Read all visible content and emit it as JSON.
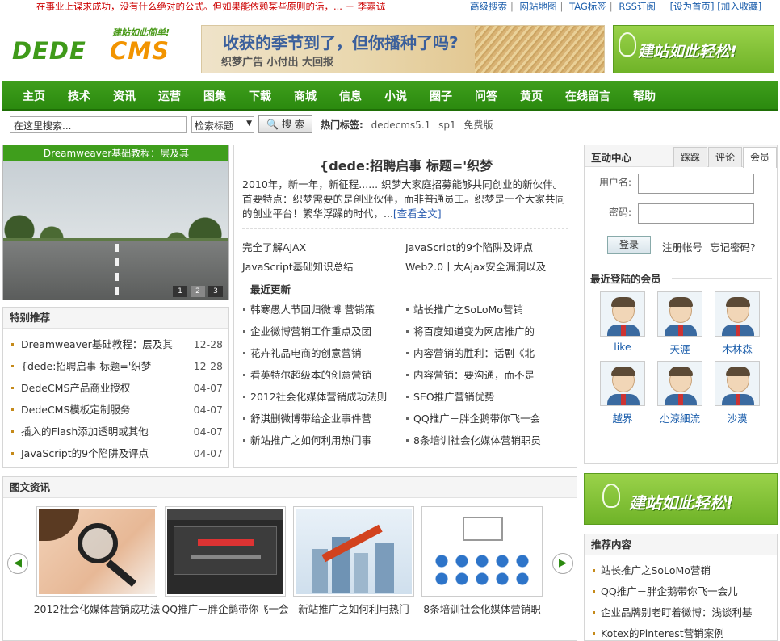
{
  "topbar": {
    "motto": "在事业上谋求成功，没有什么绝对的公式。但如果能依赖某些原则的话，... － 李嘉诚",
    "links": [
      "高级搜索",
      "网站地图",
      "TAG标签",
      "RSS订阅"
    ],
    "right_links": [
      "[设为首页]",
      "[加入收藏]"
    ]
  },
  "logo": {
    "slogan": "建站如此简单!",
    "part1": "DEDE",
    "part2": "CMS"
  },
  "banner1": {
    "title": "收获的季节到了，但你播种了吗?",
    "sub": "织梦广告 小付出 大回报"
  },
  "banner2": {
    "text": "建站如此轻松!"
  },
  "nav": [
    "主页",
    "技术",
    "资讯",
    "运营",
    "图集",
    "下载",
    "商城",
    "信息",
    "小说",
    "圈子",
    "问答",
    "黄页",
    "在线留言",
    "帮助"
  ],
  "search": {
    "value": "在这里搜索...",
    "select": "检索标题",
    "button": "搜 索",
    "hot_label": "热门标签:",
    "tags": [
      "dedecms5.1",
      "sp1",
      "免费版"
    ]
  },
  "slideshow": {
    "caption": "Dreamweaver基础教程：层及其",
    "pages": [
      "1",
      "2",
      "3"
    ]
  },
  "special": {
    "title": "特别推荐",
    "items": [
      {
        "t": "Dreamweaver基础教程：层及其",
        "d": "12-28"
      },
      {
        "t": "{dede:招聘启事 标题='织梦",
        "d": "12-28"
      },
      {
        "t": "DedeCMS产品商业授权",
        "d": "04-07"
      },
      {
        "t": "DedeCMS模板定制服务",
        "d": "04-07"
      },
      {
        "t": "插入的Flash添加透明或其他",
        "d": "04-07"
      },
      {
        "t": "JavaScript的9个陷阱及评点",
        "d": "04-07"
      }
    ]
  },
  "center": {
    "headline": "{dede:招聘启事 标题='织梦",
    "desc": "2010年，新一年，新征程...... 织梦大家庭招募能够共同创业的新伙伴。 首要特点：织梦需要的是创业伙伴，而非普通员工。织梦是一个大家共同的创业平台！繁华浮躁的时代，...",
    "more": "[查看全文]",
    "quick": [
      "完全了解AJAX",
      "JavaScript的9个陷阱及评点",
      "JavaScript基础知识总结",
      "Web2.0十大Ajax安全漏洞以及"
    ],
    "latest_title": "最近更新",
    "latest": [
      "韩寒愚人节回归微博 营销策",
      "站长推广之SoLoMo营销",
      "企业微博营销工作重点及团",
      "将百度知道变为网店推广的",
      "花卉礼品电商的创意营销",
      "内容营销的胜利：话剧《北",
      "看英特尔超级本的创意营销",
      "内容营销：要沟通，而不是",
      "2012社会化媒体营销成功法则",
      "SEO推广营销优势",
      "舒淇删微博带给企业事件营",
      "QQ推广－胖企鹅带你飞一会",
      "新站推广之如何利用热门事",
      "8条培训社会化媒体营销职员"
    ]
  },
  "member": {
    "title": "互动中心",
    "tabs": [
      "踩踩",
      "评论",
      "会员"
    ],
    "username_label": "用户名:",
    "password_label": "密码:",
    "login": "登录",
    "register": "注册帐号",
    "forgot": "忘记密码?",
    "recent_title": "最近登陆的会员",
    "users": [
      "like",
      "天涯",
      "木林森",
      "越界",
      "尐涼細流",
      "沙漠"
    ]
  },
  "banner3": {
    "text": "建站如此轻松!"
  },
  "recommend": {
    "title": "推荐内容",
    "items": [
      "站长推广之SoLoMo营销",
      "QQ推广－胖企鹅带你飞一会儿",
      "企业品牌别老盯着微博：浅谈利基",
      "Kotex的Pinterest营销案例"
    ]
  },
  "picnews": {
    "title": "图文资讯",
    "items": [
      "2012社会化媒体营销成功法",
      "QQ推广－胖企鹅带你飞一会",
      "新站推广之如何利用热门",
      "8条培训社会化媒体营销职"
    ]
  },
  "colors": {
    "green": "#2b8a0f",
    "orange": "#f29400",
    "link": "#1a5dab"
  }
}
